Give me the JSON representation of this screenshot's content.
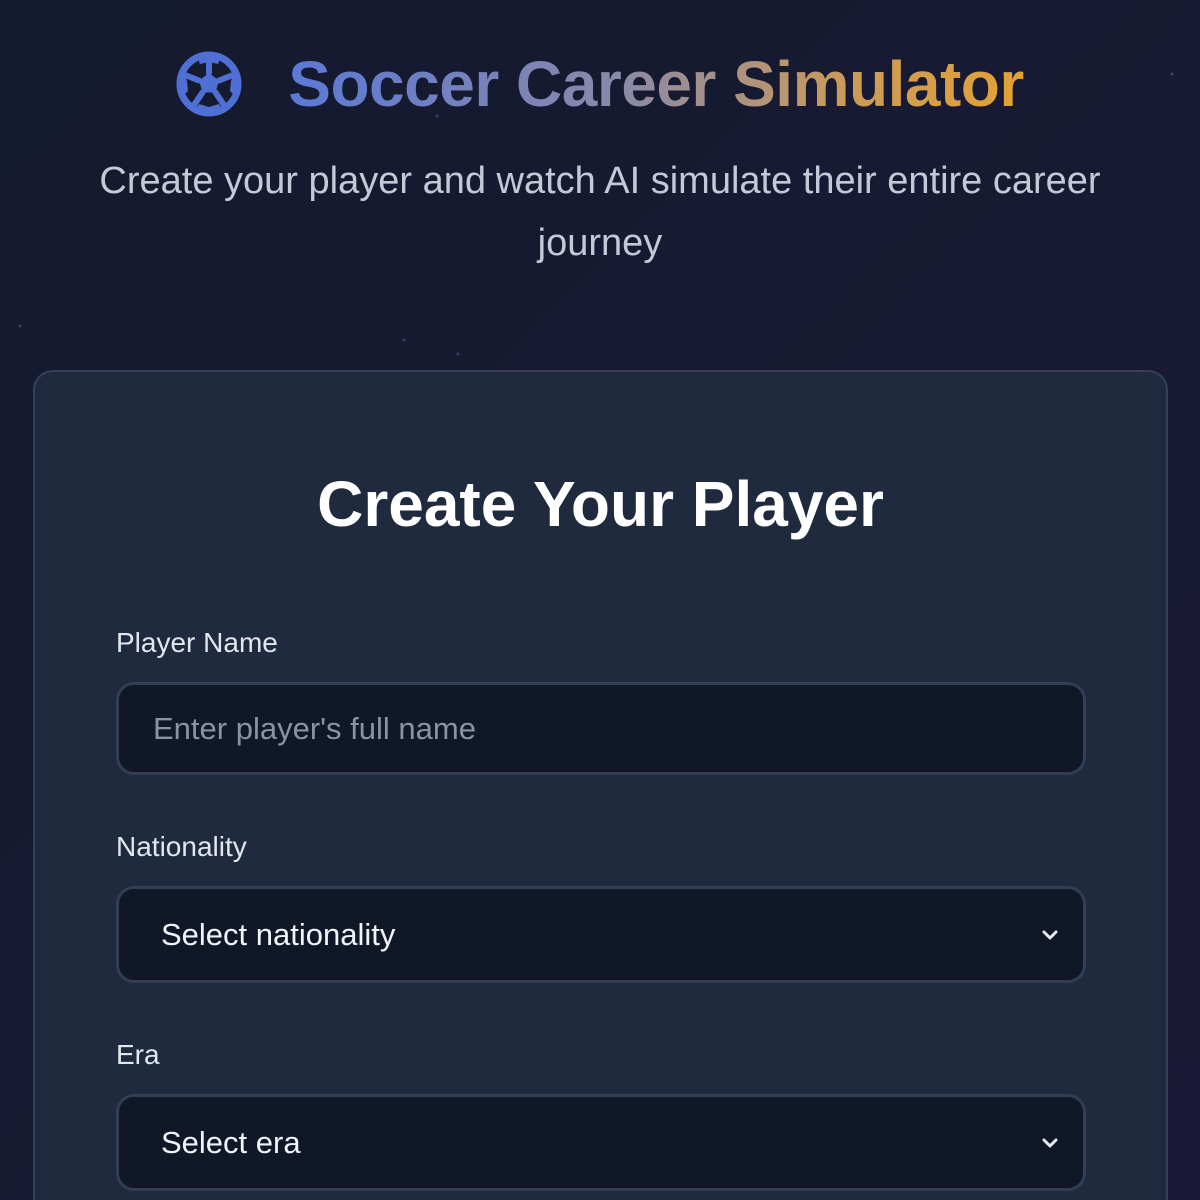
{
  "header": {
    "logo_icon": "soccer-ball-icon",
    "title": "Soccer Career Simulator",
    "subtitle": "Create your player and watch AI simulate their entire career journey",
    "title_gradient": [
      "#5b79d6",
      "#8a89a8",
      "#e3a234"
    ]
  },
  "card": {
    "title": "Create Your Player",
    "fields": {
      "player_name": {
        "label": "Player Name",
        "placeholder": "Enter player's full name",
        "value": ""
      },
      "nationality": {
        "label": "Nationality",
        "selected": "Select nationality",
        "icon": "chevron-down-icon"
      },
      "era": {
        "label": "Era",
        "selected": "Select era",
        "icon": "chevron-down-icon"
      }
    }
  },
  "colors": {
    "background": "#161b31",
    "card_background": "#1f2a3e",
    "input_background": "#101828",
    "accent_blue": "#4f6fd4",
    "accent_gold": "#e3a234"
  }
}
